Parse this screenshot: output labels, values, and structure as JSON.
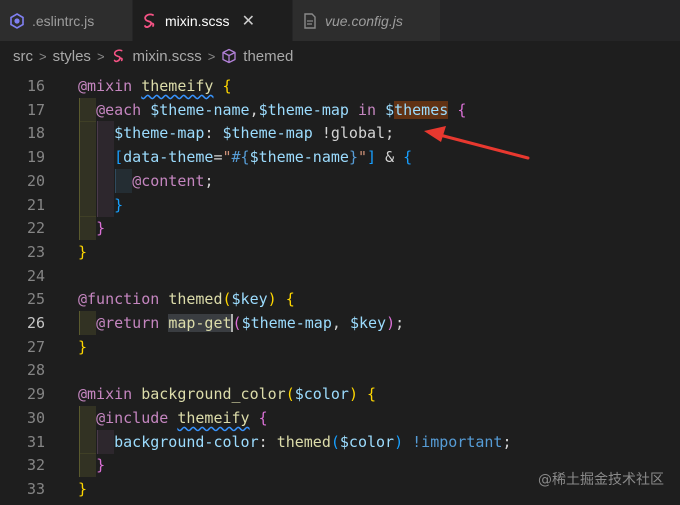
{
  "tabs": [
    {
      "label": ".eslintrc.js",
      "icon": "eslint-icon",
      "active": false,
      "italic": false
    },
    {
      "label": "mixin.scss",
      "icon": "sass-icon",
      "active": true,
      "italic": false,
      "close": "✕"
    },
    {
      "label": "vue.config.js",
      "icon": "js-file-icon",
      "active": false,
      "italic": true
    }
  ],
  "breadcrumb": {
    "items": [
      "src",
      "styles",
      "mixin.scss",
      "themed"
    ],
    "separator": ">"
  },
  "editor": {
    "current_line": 26,
    "lines": [
      {
        "n": "16",
        "tokens": [
          [
            "@mixin",
            "k"
          ],
          [
            " ",
            "p"
          ],
          [
            "themeify",
            "f sq"
          ],
          [
            " ",
            "p"
          ],
          [
            "{",
            "b1"
          ]
        ]
      },
      {
        "n": "17",
        "tokens": [
          [
            "  ",
            "p"
          ],
          [
            "@each",
            "k"
          ],
          [
            " ",
            "p"
          ],
          [
            "$theme-name",
            "v"
          ],
          [
            ",",
            "p"
          ],
          [
            "$theme-map",
            "v"
          ],
          [
            " in ",
            "k"
          ],
          [
            "$",
            "v"
          ],
          [
            "themes",
            "v hl"
          ],
          [
            " ",
            "p"
          ],
          [
            "{",
            "b2"
          ]
        ]
      },
      {
        "n": "18",
        "tokens": [
          [
            "    ",
            "p"
          ],
          [
            "$theme-map",
            "v"
          ],
          [
            ": ",
            "p"
          ],
          [
            "$theme-map",
            "v"
          ],
          [
            " ",
            "p"
          ],
          [
            "!global",
            "p"
          ],
          [
            ";",
            "p"
          ]
        ]
      },
      {
        "n": "19",
        "tokens": [
          [
            "    ",
            "p"
          ],
          [
            "[",
            "b3"
          ],
          [
            "data-theme",
            "v"
          ],
          [
            "=",
            "p"
          ],
          [
            "\"",
            "s"
          ],
          [
            "#{",
            "i"
          ],
          [
            "$theme-name",
            "v"
          ],
          [
            "}",
            "i"
          ],
          [
            "\"",
            "s"
          ],
          [
            "]",
            "b3"
          ],
          [
            " ",
            "p"
          ],
          [
            "&",
            "p"
          ],
          [
            " ",
            "p"
          ],
          [
            "{",
            "b3"
          ]
        ]
      },
      {
        "n": "20",
        "tokens": [
          [
            "      ",
            "p"
          ],
          [
            "@content",
            "k"
          ],
          [
            ";",
            "p"
          ]
        ]
      },
      {
        "n": "21",
        "tokens": [
          [
            "    ",
            "p"
          ],
          [
            "}",
            "b3"
          ]
        ]
      },
      {
        "n": "22",
        "tokens": [
          [
            "  ",
            "p"
          ],
          [
            "}",
            "b2"
          ]
        ]
      },
      {
        "n": "23",
        "tokens": [
          [
            "}",
            "b1"
          ]
        ]
      },
      {
        "n": "24",
        "tokens": []
      },
      {
        "n": "25",
        "tokens": [
          [
            "@function",
            "k"
          ],
          [
            " ",
            "p"
          ],
          [
            "themed",
            "f"
          ],
          [
            "(",
            "b1"
          ],
          [
            "$key",
            "v"
          ],
          [
            ")",
            "b1"
          ],
          [
            " ",
            "p"
          ],
          [
            "{",
            "b1"
          ]
        ]
      },
      {
        "n": "26",
        "tokens": [
          [
            "  ",
            "p"
          ],
          [
            "@return",
            "k"
          ],
          [
            " ",
            "p"
          ],
          [
            "map-get",
            "f sel"
          ],
          [
            "(",
            "b2 cursor"
          ],
          [
            "$theme-map",
            "v"
          ],
          [
            ", ",
            "p"
          ],
          [
            "$key",
            "v"
          ],
          [
            ")",
            "b2"
          ],
          [
            ";",
            "p"
          ]
        ]
      },
      {
        "n": "27",
        "tokens": [
          [
            "}",
            "b1"
          ]
        ]
      },
      {
        "n": "28",
        "tokens": []
      },
      {
        "n": "29",
        "tokens": [
          [
            "@mixin",
            "k"
          ],
          [
            " ",
            "p"
          ],
          [
            "background_color",
            "f"
          ],
          [
            "(",
            "b1"
          ],
          [
            "$color",
            "v"
          ],
          [
            ")",
            "b1"
          ],
          [
            " ",
            "p"
          ],
          [
            "{",
            "b1"
          ]
        ]
      },
      {
        "n": "30",
        "tokens": [
          [
            "  ",
            "p"
          ],
          [
            "@include",
            "k"
          ],
          [
            " ",
            "p"
          ],
          [
            "themeify",
            "f sq"
          ],
          [
            " ",
            "p"
          ],
          [
            "{",
            "b2"
          ]
        ]
      },
      {
        "n": "31",
        "tokens": [
          [
            "    ",
            "p"
          ],
          [
            "background-color",
            "v"
          ],
          [
            ": ",
            "p"
          ],
          [
            "themed",
            "f"
          ],
          [
            "(",
            "b3"
          ],
          [
            "$color",
            "v"
          ],
          [
            ")",
            "b3"
          ],
          [
            " ",
            "p"
          ],
          [
            "!important",
            "i"
          ],
          [
            ";",
            "p"
          ]
        ]
      },
      {
        "n": "32",
        "tokens": [
          [
            "  ",
            "p"
          ],
          [
            "}",
            "b2"
          ]
        ]
      },
      {
        "n": "33",
        "tokens": [
          [
            "}",
            "b1"
          ]
        ]
      }
    ]
  },
  "annotation": {
    "color": "#e8382f"
  },
  "watermark": "@稀土掘金技术社区"
}
